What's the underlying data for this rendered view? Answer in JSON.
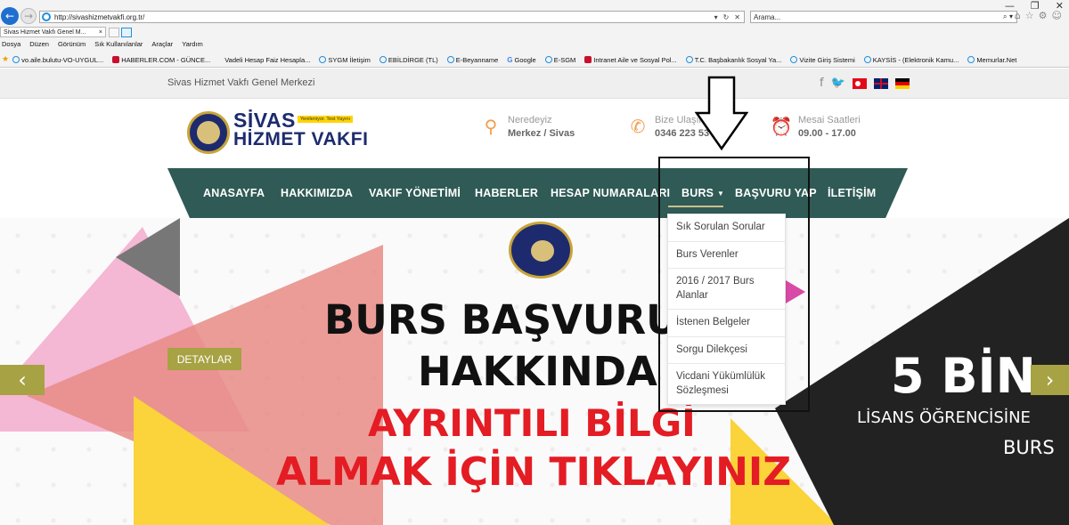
{
  "browser": {
    "window_controls": [
      "—",
      "❐",
      "✕"
    ],
    "url": "http://sivashizmetvakfi.org.tr/",
    "url_controls": [
      "▾",
      "↻",
      "✕"
    ],
    "search_placeholder": "Arama...",
    "search_controls": "⌕ ▾",
    "tab_title": "Sivas Hizmet Vakfı Genel M...",
    "tab_close": "×",
    "menu": [
      "Dosya",
      "Düzen",
      "Görünüm",
      "Sık Kullanılanlar",
      "Araçlar",
      "Yardım"
    ],
    "favorites": [
      {
        "label": "vo.aile.bulutu-VO-UYGUL...",
        "icon": "ie"
      },
      {
        "label": "HABERLER.COM - GÜNCE...",
        "icon": "red"
      },
      {
        "label": "Vadeli Hesap Faiz Hesapla...",
        "icon": "none"
      },
      {
        "label": "SYGM İletişim",
        "icon": "ie"
      },
      {
        "label": "EBİLDİRGE (TL)",
        "icon": "ie"
      },
      {
        "label": "E-Beyanname",
        "icon": "ie"
      },
      {
        "label": "Google",
        "icon": "g"
      },
      {
        "label": "E-SGM",
        "icon": "ie"
      },
      {
        "label": "Intranet  Aile ve Sosyal Pol...",
        "icon": "red"
      },
      {
        "label": "T.C. Başbakanlık Sosyal Ya...",
        "icon": "ie"
      },
      {
        "label": "Vizite Giriş Sistemi",
        "icon": "ie"
      },
      {
        "label": "KAYSİS - (Elektronik Kamu...",
        "icon": "ie"
      },
      {
        "label": "Memurlar.Net",
        "icon": "ie"
      }
    ]
  },
  "site": {
    "topbar_title": "Sivas Hizmet Vakfı Genel Merkezi",
    "logo": {
      "line1": "SİVAS",
      "line2": "HİZMET VAKFI",
      "badge": "Yenileniyor. Test Yayını"
    },
    "info": [
      {
        "label": "Neredeyiz",
        "value": "Merkez / Sivas",
        "icon": "location-icon"
      },
      {
        "label": "Bize Ulaşın",
        "value": "0346 223 53 56",
        "icon": "phone-icon"
      },
      {
        "label": "Mesai Saatleri",
        "value": "09.00 - 17.00",
        "icon": "clock-icon"
      }
    ],
    "nav": [
      "ANASAYFA",
      "HAKKIMIZDA",
      "VAKIF YÖNETİMİ",
      "HABERLER",
      "HESAP NUMARALARI",
      "BURS",
      "BAŞVURU YAP",
      "İLETİŞİM"
    ],
    "nav_caret": "▼",
    "dropdown": [
      "Sık Sorulan Sorular",
      "Burs Verenler",
      "2016 / 2017 Burs Alanlar",
      "İstenen Belgeler",
      "Sorgu Dilekçesi",
      "Vicdani Yükümlülük Sözleşmesi"
    ],
    "hero": {
      "line1": "BURS BAŞVURU",
      "line2": "HAKKINDA",
      "line3": "AYRINTILI BİLGİ",
      "line4": "ALMAK İÇİN TIKLAYINIZ",
      "detail_button": "DETAYLAR",
      "prev": "‹",
      "next": "›",
      "right_big": "5 BİN",
      "right_sub1": "LİSANS ÖĞRENCİSİNE",
      "right_sub2": "BURS"
    }
  }
}
